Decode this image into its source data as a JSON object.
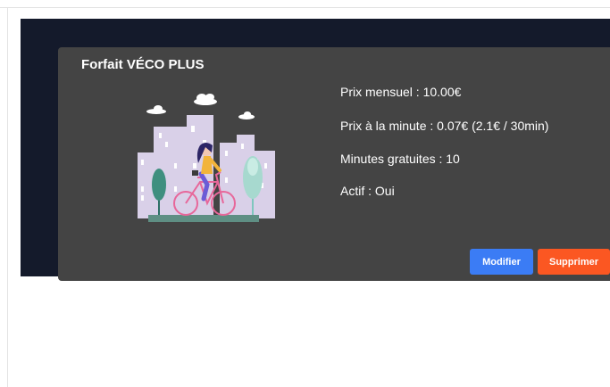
{
  "card": {
    "title": "Forfait VÉCO PLUS",
    "details": [
      "Prix mensuel : 10.00€",
      "Prix à la minute : 0.07€ (2.1€ / 30min)",
      "Minutes gratuites : 10",
      "Actif : Oui"
    ],
    "buttons": {
      "edit_label": "Modifier",
      "delete_label": "Supprimer"
    }
  },
  "colors": {
    "panel_background": "#141a2b",
    "card_background": "#444444",
    "edit_button": "#3b7cf5",
    "delete_button": "#fb5722"
  },
  "icons": {
    "illustration": "woman-riding-bicycle-illustration"
  }
}
